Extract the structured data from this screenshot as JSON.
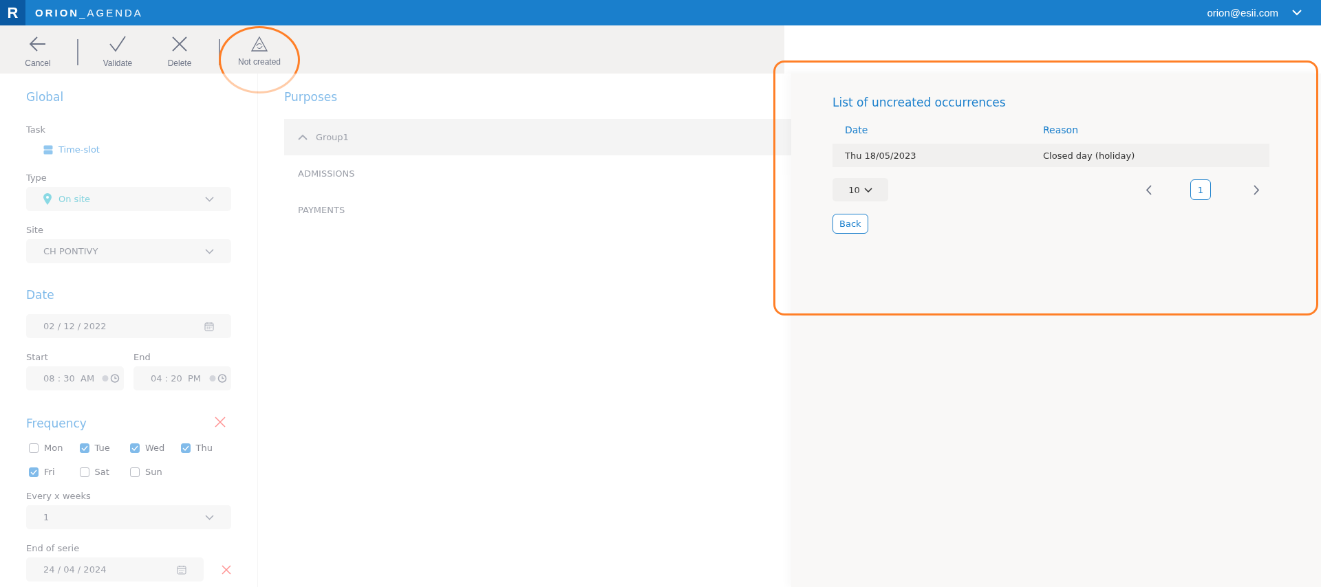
{
  "header": {
    "logo": "R",
    "title": "**ORION**_AGENDA",
    "user": "orion@esii.com"
  },
  "toolbar": [
    [
      {
        "kind": "back",
        "label": "Cancel",
        "highlighted": false
      }
    ],
    [
      {
        "kind": "check",
        "label": "Validate",
        "highlighted": false
      },
      {
        "kind": "close",
        "label": "Delete",
        "highlighted": false
      }
    ],
    [
      {
        "kind": "warning",
        "label": "Not created",
        "highlighted": true
      }
    ]
  ],
  "editor": {
    "disabled": true,
    "global": {
      "heading": "Global",
      "task_label": "Task",
      "task_value": "Time-slot",
      "type_label": "Type",
      "type_value": "On site",
      "site_label": "Site",
      "site_value": "CH PONTIVY"
    },
    "date": {
      "heading": "Date",
      "date_value": "02 / 12 / 2022",
      "start_label": "Start",
      "start_value": "08 : 30  AM",
      "end_label": "End",
      "end_value": "04 : 20  PM"
    },
    "frequency": {
      "heading": "Frequency",
      "days": [
        {
          "label": "Mon",
          "checked": false
        },
        {
          "label": "Tue",
          "checked": true
        },
        {
          "label": "Wed",
          "checked": true
        },
        {
          "label": "Thu",
          "checked": true
        },
        {
          "label": "Fri",
          "checked": true
        },
        {
          "label": "Sat",
          "checked": false
        },
        {
          "label": "Sun",
          "checked": false
        }
      ],
      "weeks_label": "Every x weeks",
      "weeks_value": "1",
      "end_label": "End of serie",
      "end_value": "24 / 04 / 2024"
    },
    "purposes": {
      "heading": "Purposes",
      "group": {
        "label": "Group1",
        "expanded": true,
        "children": [
          {
            "label": "ADMISSIONS"
          },
          {
            "label": "PAYMENTS"
          }
        ]
      }
    }
  },
  "panel": {
    "title": "List of uncreated occurrences",
    "columns": [
      "Date",
      "Reason"
    ],
    "rows": [
      [
        "Thu 18/05/2023",
        "Closed day (holiday)"
      ]
    ],
    "page_size": "10",
    "pages": [
      {
        "label": "1",
        "selected": true
      }
    ],
    "back": "Back",
    "highlighted": true
  }
}
